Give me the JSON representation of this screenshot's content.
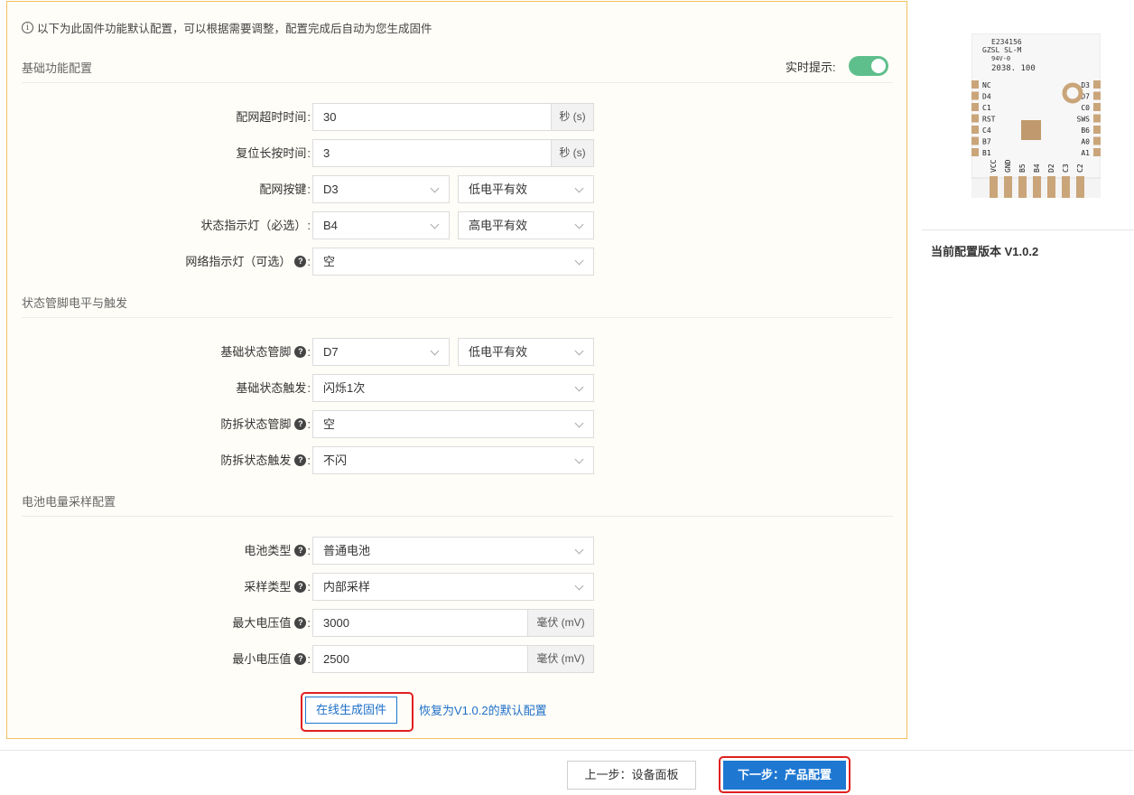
{
  "notice": {
    "icon": "info-icon",
    "text": "以下为此固件功能默认配置，可以根据需要调整，配置完成后自动为您生成固件"
  },
  "sections": {
    "basic": "基础功能配置",
    "status_pin": "状态管脚电平与触发",
    "battery": "电池电量采样配置"
  },
  "realtime": {
    "label": "实时提示:",
    "enabled": true,
    "accent": "#5fbf8c"
  },
  "basic": {
    "timeout": {
      "label": "配网超时时间",
      "value": "30",
      "unit": "秒 (s)"
    },
    "reset_hold": {
      "label": "复位长按时间",
      "value": "3",
      "unit": "秒 (s)"
    },
    "pair_key": {
      "label": "配网按键",
      "pin": "D3",
      "level": "低电平有效"
    },
    "status_led": {
      "label": "状态指示灯（必选）",
      "pin": "B4",
      "level": "高电平有效"
    },
    "net_led": {
      "label": "网络指示灯（可选）",
      "value": "空"
    }
  },
  "status": {
    "base_pin": {
      "label": "基础状态管脚",
      "pin": "D7",
      "level": "低电平有效"
    },
    "base_trigger": {
      "label": "基础状态触发",
      "value": "闪烁1次"
    },
    "tamper_pin": {
      "label": "防拆状态管脚",
      "value": "空"
    },
    "tamper_trigger": {
      "label": "防拆状态触发",
      "value": "不闪"
    }
  },
  "battery": {
    "type": {
      "label": "电池类型",
      "value": "普通电池"
    },
    "sampling": {
      "label": "采样类型",
      "value": "内部采样"
    },
    "max_v": {
      "label": "最大电压值",
      "value": "3000",
      "unit": "毫伏 (mV)"
    },
    "min_v": {
      "label": "最小电压值",
      "value": "2500",
      "unit": "毫伏 (mV)"
    }
  },
  "actions": {
    "generate": "在线生成固件",
    "restore": "恢复为V1.0.2的默认配置"
  },
  "chip": {
    "marking": [
      "E234156",
      "GZSL SL-M",
      "94V-0",
      "2038. 100"
    ],
    "left_pins": [
      "NC",
      "D4",
      "C1",
      "RST",
      "C4",
      "B7",
      "B1"
    ],
    "right_pins": [
      "D3",
      "D7",
      "C0",
      "SWS",
      "B6",
      "A0",
      "A1"
    ],
    "bottom_pins": [
      "VCC",
      "GND",
      "B5",
      "B4",
      "D2",
      "C3",
      "C2"
    ],
    "colors": {
      "board": "#f4f4f4",
      "pad": "#caa57a"
    }
  },
  "version": "当前配置版本 V1.0.2",
  "footer": {
    "prev": "上一步：设备面板",
    "next": "下一步：产品配置"
  },
  "colors": {
    "primary": "#1e78d2",
    "highlight": "#e02020",
    "panel_border": "#f0c060",
    "panel_bg": "#fffdf7"
  }
}
